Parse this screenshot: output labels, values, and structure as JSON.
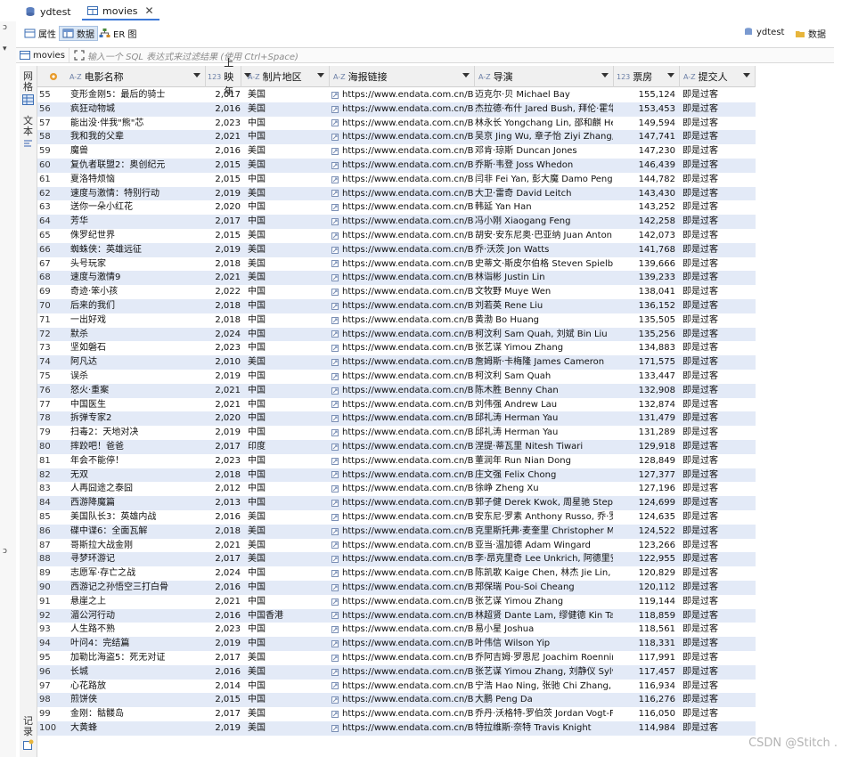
{
  "tabs": [
    {
      "label": "ydtest",
      "active": false
    },
    {
      "label": "movies",
      "active": true
    }
  ],
  "subtabs": [
    {
      "label": "属性",
      "selected": false
    },
    {
      "label": "数据",
      "selected": true
    },
    {
      "label": "ER 图",
      "selected": false
    }
  ],
  "right_links": {
    "db": "ydtest",
    "data": "数据"
  },
  "filter": {
    "table": "movies",
    "placeholder": "输入一个 SQL 表达式来过滤结果 (使用 Ctrl+Space)"
  },
  "vertical_panel": {
    "top": "网格",
    "mid": "文本",
    "bottom": "记录"
  },
  "side_chars": [
    "ɔ",
    "▾",
    "ɔ"
  ],
  "columns": [
    {
      "type": "A-Z",
      "label": "电影名称"
    },
    {
      "type": "123",
      "label": "上映年"
    },
    {
      "type": "A-Z",
      "label": "制片地区"
    },
    {
      "type": "A-Z",
      "label": "海报链接"
    },
    {
      "type": "A-Z",
      "label": "导演"
    },
    {
      "type": "123",
      "label": "票房"
    },
    {
      "type": "A-Z",
      "label": "提交人"
    }
  ],
  "rows": [
    {
      "idx": "55",
      "name": "变形金刚5：最后的骑士",
      "year": "2,017",
      "region": "美国",
      "link": "https://www.endata.com.cn/Box",
      "director": "迈克尔·贝 Michael Bay",
      "box": "155,124",
      "submitter": "即是过客"
    },
    {
      "idx": "56",
      "name": "疯狂动物城",
      "year": "2,016",
      "region": "美国",
      "link": "https://www.endata.com.cn/Box",
      "director": "杰拉德·布什 Jared Bush, 拜伦·霍华",
      "box": "153,453",
      "submitter": "即是过客"
    },
    {
      "idx": "57",
      "name": "能出没·伴我\"熊\"芯",
      "year": "2,023",
      "region": "中国",
      "link": "https://www.endata.com.cn/Box",
      "director": "林永长 Yongchang Lin, 邵和麒 He",
      "box": "149,594",
      "submitter": "即是过客"
    },
    {
      "idx": "58",
      "name": "我和我的父辈",
      "year": "2,021",
      "region": "中国",
      "link": "https://www.endata.com.cn/Box",
      "director": "吴京 Jing Wu, 章子怡 Ziyi Zhang, 徐",
      "box": "147,741",
      "submitter": "即是过客"
    },
    {
      "idx": "59",
      "name": "魔兽",
      "year": "2,016",
      "region": "美国",
      "link": "https://www.endata.com.cn/Box",
      "director": "邓肯·琼斯 Duncan Jones",
      "box": "147,230",
      "submitter": "即是过客"
    },
    {
      "idx": "60",
      "name": "复仇者联盟2：奥创纪元",
      "year": "2,015",
      "region": "美国",
      "link": "https://www.endata.com.cn/Box",
      "director": "乔斯·韦登 Joss Whedon",
      "box": "146,439",
      "submitter": "即是过客"
    },
    {
      "idx": "61",
      "name": "夏洛特烦恼",
      "year": "2,015",
      "region": "中国",
      "link": "https://www.endata.com.cn/Box",
      "director": "闫非 Fei Yan, 彭大魔 Damo Peng, 周",
      "box": "144,782",
      "submitter": "即是过客"
    },
    {
      "idx": "62",
      "name": "速度与激情：特别行动",
      "year": "2,019",
      "region": "美国",
      "link": "https://www.endata.com.cn/Box",
      "director": "大卫·雷奇 David Leitch",
      "box": "143,430",
      "submitter": "即是过客"
    },
    {
      "idx": "63",
      "name": "送你一朵小红花",
      "year": "2,020",
      "region": "中国",
      "link": "https://www.endata.com.cn/Box",
      "director": "韩延 Yan Han",
      "box": "143,252",
      "submitter": "即是过客"
    },
    {
      "idx": "64",
      "name": "芳华",
      "year": "2,017",
      "region": "中国",
      "link": "https://www.endata.com.cn/Box",
      "director": "冯小刚 Xiaogang Feng",
      "box": "142,258",
      "submitter": "即是过客"
    },
    {
      "idx": "65",
      "name": "侏罗纪世界",
      "year": "2,015",
      "region": "美国",
      "link": "https://www.endata.com.cn/Box",
      "director": "胡安·安东尼奥·巴亚纳 Juan Anton",
      "box": "142,073",
      "submitter": "即是过客"
    },
    {
      "idx": "66",
      "name": "蜘蛛侠：英雄远征",
      "year": "2,019",
      "region": "美国",
      "link": "https://www.endata.com.cn/Box",
      "director": "乔·沃茨 Jon Watts",
      "box": "141,768",
      "submitter": "即是过客"
    },
    {
      "idx": "67",
      "name": "头号玩家",
      "year": "2,018",
      "region": "美国",
      "link": "https://www.endata.com.cn/Box",
      "director": "史蒂文·斯皮尔伯格 Steven Spielbe",
      "box": "139,666",
      "submitter": "即是过客"
    },
    {
      "idx": "68",
      "name": "速度与激情9",
      "year": "2,021",
      "region": "美国",
      "link": "https://www.endata.com.cn/Box",
      "director": "林诣彬 Justin Lin",
      "box": "139,233",
      "submitter": "即是过客"
    },
    {
      "idx": "69",
      "name": "奇迹·笨小孩",
      "year": "2,022",
      "region": "中国",
      "link": "https://www.endata.com.cn/Box",
      "director": "文牧野 Muye Wen",
      "box": "138,041",
      "submitter": "即是过客"
    },
    {
      "idx": "70",
      "name": "后来的我们",
      "year": "2,018",
      "region": "中国",
      "link": "https://www.endata.com.cn/Box",
      "director": "刘若英 Rene Liu",
      "box": "136,152",
      "submitter": "即是过客"
    },
    {
      "idx": "71",
      "name": "一出好戏",
      "year": "2,018",
      "region": "中国",
      "link": "https://www.endata.com.cn/Box",
      "director": "黄渤 Bo Huang",
      "box": "135,505",
      "submitter": "即是过客"
    },
    {
      "idx": "72",
      "name": "默杀",
      "year": "2,024",
      "region": "中国",
      "link": "https://www.endata.com.cn/Box",
      "director": "柯汶利 Sam Quah, 刘斌 Bin Liu",
      "box": "135,256",
      "submitter": "即是过客"
    },
    {
      "idx": "73",
      "name": "坚如磐石",
      "year": "2,023",
      "region": "中国",
      "link": "https://www.endata.com.cn/Box",
      "director": "张艺谋 Yimou Zhang",
      "box": "134,883",
      "submitter": "即是过客"
    },
    {
      "idx": "74",
      "name": "阿凡达",
      "year": "2,010",
      "region": "美国",
      "link": "https://www.endata.com.cn/Box",
      "director": "詹姆斯·卡梅隆 James Cameron",
      "box": "171,575",
      "submitter": "即是过客"
    },
    {
      "idx": "75",
      "name": "误杀",
      "year": "2,019",
      "region": "中国",
      "link": "https://www.endata.com.cn/Box",
      "director": "柯汶利 Sam Quah",
      "box": "133,447",
      "submitter": "即是过客"
    },
    {
      "idx": "76",
      "name": "怒火·重案",
      "year": "2,021",
      "region": "中国",
      "link": "https://www.endata.com.cn/Box",
      "director": "陈木胜 Benny Chan",
      "box": "132,908",
      "submitter": "即是过客"
    },
    {
      "idx": "77",
      "name": "中国医生",
      "year": "2,021",
      "region": "中国",
      "link": "https://www.endata.com.cn/Box",
      "director": "刘伟强 Andrew Lau",
      "box": "132,874",
      "submitter": "即是过客"
    },
    {
      "idx": "78",
      "name": "拆弹专家2",
      "year": "2,020",
      "region": "中国",
      "link": "https://www.endata.com.cn/Box",
      "director": "邱礼涛 Herman Yau",
      "box": "131,479",
      "submitter": "即是过客"
    },
    {
      "idx": "79",
      "name": "扫毒2：天地对决",
      "year": "2,019",
      "region": "中国",
      "link": "https://www.endata.com.cn/Box",
      "director": "邱礼涛 Herman Yau",
      "box": "131,289",
      "submitter": "即是过客"
    },
    {
      "idx": "80",
      "name": "摔跤吧！爸爸",
      "year": "2,017",
      "region": "印度",
      "link": "https://www.endata.com.cn/Box",
      "director": "涅提·蒂瓦里 Nitesh Tiwari",
      "box": "129,918",
      "submitter": "即是过客"
    },
    {
      "idx": "81",
      "name": "年会不能停！",
      "year": "2,023",
      "region": "中国",
      "link": "https://www.endata.com.cn/Box",
      "director": "董润年 Run Nian Dong",
      "box": "128,849",
      "submitter": "即是过客"
    },
    {
      "idx": "82",
      "name": "无双",
      "year": "2,018",
      "region": "中国",
      "link": "https://www.endata.com.cn/Box",
      "director": "庄文强 Felix Chong",
      "box": "127,377",
      "submitter": "即是过客"
    },
    {
      "idx": "83",
      "name": "人再囧途之泰囧",
      "year": "2,012",
      "region": "中国",
      "link": "https://www.endata.com.cn/Box",
      "director": "徐峥 Zheng Xu",
      "box": "127,196",
      "submitter": "即是过客"
    },
    {
      "idx": "84",
      "name": "西游降魔篇",
      "year": "2,013",
      "region": "中国",
      "link": "https://www.endata.com.cn/Box",
      "director": "郭子健 Derek Kwok, 周星驰 Stephe",
      "box": "124,699",
      "submitter": "即是过客"
    },
    {
      "idx": "85",
      "name": "美国队长3：英雄内战",
      "year": "2,016",
      "region": "美国",
      "link": "https://www.endata.com.cn/Box",
      "director": "安东尼·罗素 Anthony Russo, 乔·罗",
      "box": "124,635",
      "submitter": "即是过客"
    },
    {
      "idx": "86",
      "name": "碟中谍6：全面瓦解",
      "year": "2,018",
      "region": "美国",
      "link": "https://www.endata.com.cn/Box",
      "director": "克里斯托弗·麦奎里 Christopher M",
      "box": "124,522",
      "submitter": "即是过客"
    },
    {
      "idx": "87",
      "name": "哥斯拉大战金刚",
      "year": "2,021",
      "region": "美国",
      "link": "https://www.endata.com.cn/Box",
      "director": "亚当·温加德 Adam Wingard",
      "box": "123,266",
      "submitter": "即是过客"
    },
    {
      "idx": "88",
      "name": "寻梦环游记",
      "year": "2,017",
      "region": "美国",
      "link": "https://www.endata.com.cn/Box",
      "director": "李·昂克里奇 Lee Unkrich, 阿德里安",
      "box": "122,955",
      "submitter": "即是过客"
    },
    {
      "idx": "89",
      "name": "志愿军·存亡之战",
      "year": "2,024",
      "region": "中国",
      "link": "https://www.endata.com.cn/Box",
      "director": "陈凯歌 Kaige Chen, 林杰 Jie Lin, 陈",
      "box": "120,829",
      "submitter": "即是过客"
    },
    {
      "idx": "90",
      "name": "西游记之孙悟空三打白骨",
      "year": "2,016",
      "region": "中国",
      "link": "https://www.endata.com.cn/Box",
      "director": "郑保瑞 Pou-Soi Cheang",
      "box": "120,112",
      "submitter": "即是过客"
    },
    {
      "idx": "91",
      "name": "悬崖之上",
      "year": "2,021",
      "region": "中国",
      "link": "https://www.endata.com.cn/Box",
      "director": "张艺谋 Yimou Zhang",
      "box": "119,144",
      "submitter": "即是过客"
    },
    {
      "idx": "92",
      "name": "湄公河行动",
      "year": "2,016",
      "region": "中国香港",
      "link": "https://www.endata.com.cn/Box",
      "director": "林超贤 Dante Lam, 缪健德 Kin Tak",
      "box": "118,859",
      "submitter": "即是过客"
    },
    {
      "idx": "93",
      "name": "人生路不熟",
      "year": "2,023",
      "region": "中国",
      "link": "https://www.endata.com.cn/Box",
      "director": "易小星 Joshua",
      "box": "118,561",
      "submitter": "即是过客"
    },
    {
      "idx": "94",
      "name": "叶问4：完结篇",
      "year": "2,019",
      "region": "中国",
      "link": "https://www.endata.com.cn/Box",
      "director": "叶伟信 Wilson Yip",
      "box": "118,331",
      "submitter": "即是过客"
    },
    {
      "idx": "95",
      "name": "加勒比海盗5：死无对证",
      "year": "2,017",
      "region": "美国",
      "link": "https://www.endata.com.cn/Box",
      "director": "乔阿吉姆·罗恩尼 Joachim Roennir",
      "box": "117,991",
      "submitter": "即是过客"
    },
    {
      "idx": "96",
      "name": "长城",
      "year": "2,016",
      "region": "美国",
      "link": "https://www.endata.com.cn/Box",
      "director": "张艺谋 Yimou Zhang, 刘静仪 Sylvi",
      "box": "117,457",
      "submitter": "即是过客"
    },
    {
      "idx": "97",
      "name": "心花路放",
      "year": "2,014",
      "region": "中国",
      "link": "https://www.endata.com.cn/Box",
      "director": "宁浩 Hao Ning, 张驰 Chi Zhang, 巴",
      "box": "116,934",
      "submitter": "即是过客"
    },
    {
      "idx": "98",
      "name": "煎饼侠",
      "year": "2,015",
      "region": "中国",
      "link": "https://www.endata.com.cn/Box",
      "director": "大鹏 Peng Da",
      "box": "116,276",
      "submitter": "即是过客"
    },
    {
      "idx": "99",
      "name": "金刚：骷髅岛",
      "year": "2,017",
      "region": "美国",
      "link": "https://www.endata.com.cn/Box",
      "director": "乔丹·沃格特-罗伯茨 Jordan Vogt-F",
      "box": "116,050",
      "submitter": "即是过客"
    },
    {
      "idx": "100",
      "name": "大黄蜂",
      "year": "2,019",
      "region": "美国",
      "link": "https://www.endata.com.cn/Box",
      "director": "特拉维斯·奈特 Travis Knight",
      "box": "114,984",
      "submitter": "即是过客"
    }
  ],
  "watermark": "CSDN @Stitch .",
  "colors": {
    "row_alt": "#e3eaf7",
    "accent": "#3c78d8"
  }
}
